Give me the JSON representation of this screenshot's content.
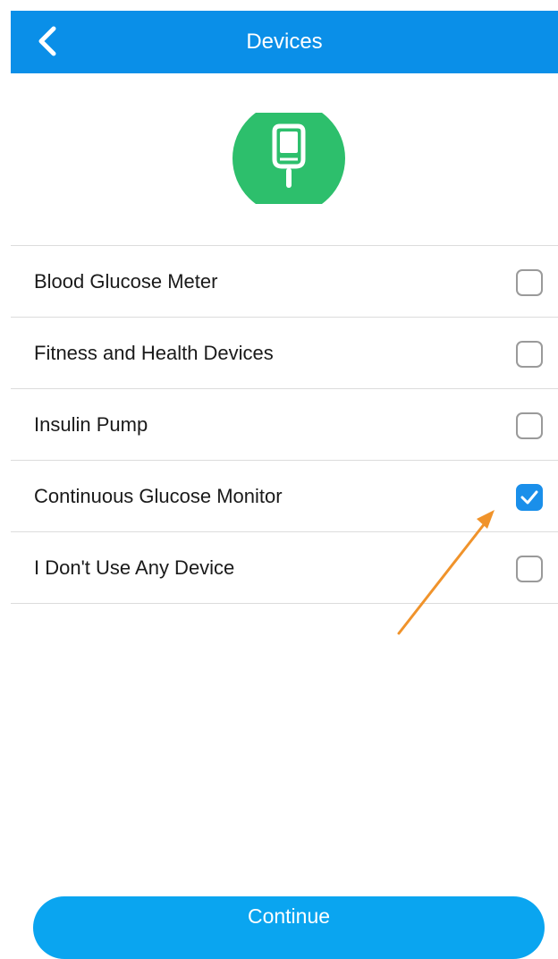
{
  "header": {
    "title": "Devices",
    "back_icon": "chevron-left-icon",
    "background_color": "#0a8fe8"
  },
  "device_icon": {
    "icon": "glucose-meter-icon",
    "color": "#2dbf6c"
  },
  "devices": {
    "items": [
      {
        "label": "Blood Glucose Meter",
        "checked": false
      },
      {
        "label": "Fitness and Health Devices",
        "checked": false
      },
      {
        "label": "Insulin Pump",
        "checked": false
      },
      {
        "label": "Continuous Glucose Monitor",
        "checked": true
      },
      {
        "label": "I Don't Use Any Device",
        "checked": false
      }
    ]
  },
  "annotation": {
    "icon": "arrow-icon",
    "color": "#f0932b"
  },
  "footer": {
    "continue_label": "Continue",
    "button_color": "#0aa5f0"
  }
}
